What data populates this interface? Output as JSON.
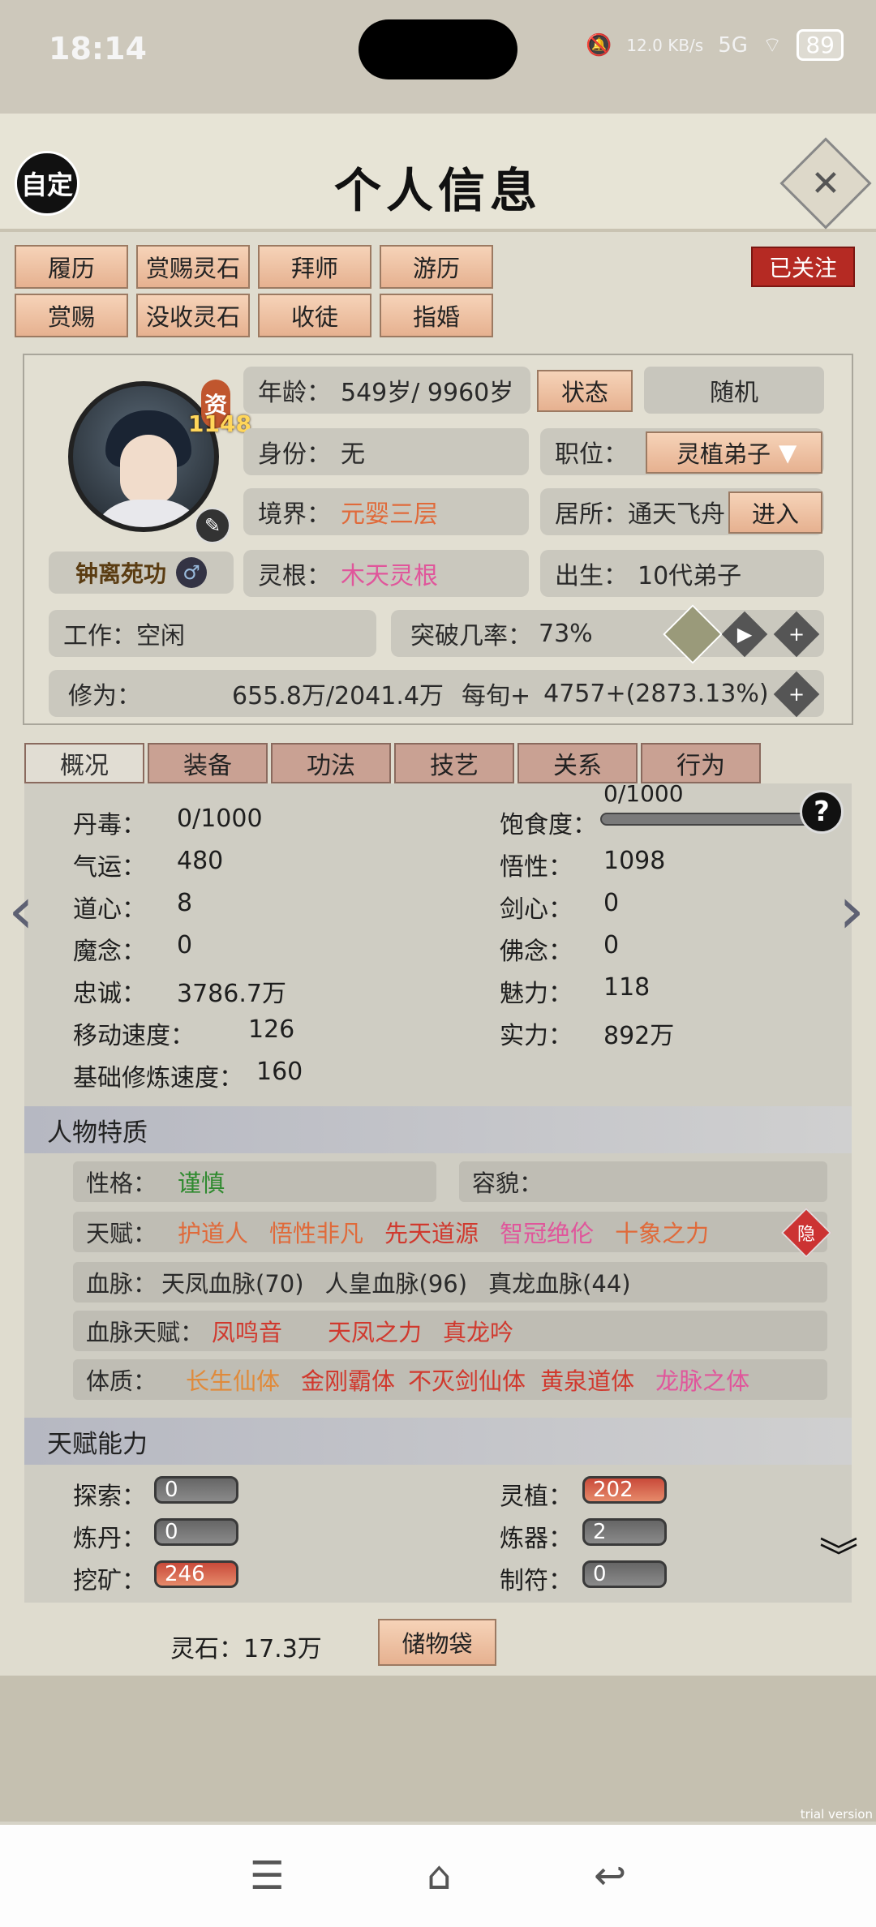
{
  "status_bar": {
    "time": "18:14",
    "network_speed": "12.0 KB/s",
    "signal": "5G",
    "battery": "89"
  },
  "header": {
    "custom_label": "自定",
    "title": "个人信息"
  },
  "actions": {
    "row1": [
      "履历",
      "赏赐灵石",
      "拜师",
      "游历"
    ],
    "row2": [
      "赏赐",
      "没收灵石",
      "收徒",
      "指婚"
    ],
    "follow_label": "已关注"
  },
  "profile": {
    "zi_label": "资",
    "zi_value": "1148",
    "name": "钟离苑功",
    "gender_symbol": "♂",
    "age_label": "年龄：",
    "age_value": "549岁/ 9960岁",
    "status_button": "状态",
    "random_button": "随机",
    "identity_label": "身份：",
    "identity_value": "无",
    "position_label": "职位：",
    "position_value": "灵植弟子",
    "realm_label": "境界：",
    "realm_value": "元婴三层",
    "residence_label": "居所：",
    "residence_value": "通天飞舟",
    "enter_button": "进入",
    "root_label": "灵根：",
    "root_value": "木天灵根",
    "birth_label": "出生：",
    "birth_value": "10代弟子",
    "work_label": "工作：",
    "work_value": "空闲",
    "breakthrough_label": "突破几率：",
    "breakthrough_value": "73%",
    "cultivation_label": "修为：",
    "cultivation_value": "655.8万/2041.4万",
    "per_turn_label": "每旬+",
    "per_turn_value": "4757+(2873.13%)"
  },
  "tabs": [
    "概况",
    "装备",
    "功法",
    "技艺",
    "关系",
    "行为"
  ],
  "stats_left": [
    {
      "label": "丹毒：",
      "value": "0/1000"
    },
    {
      "label": "气运：",
      "value": "480"
    },
    {
      "label": "道心：",
      "value": "8"
    },
    {
      "label": "魔念：",
      "value": "0"
    },
    {
      "label": "忠诚：",
      "value": "3786.7万"
    },
    {
      "label": "移动速度：",
      "value": "126"
    },
    {
      "label": "基础修炼速度：",
      "value": "160"
    }
  ],
  "stats_right": [
    {
      "label": "饱食度：",
      "value": "0/1000"
    },
    {
      "label": "悟性：",
      "value": "1098"
    },
    {
      "label": "剑心：",
      "value": "0"
    },
    {
      "label": "佛念：",
      "value": "0"
    },
    {
      "label": "魅力：",
      "value": "118"
    },
    {
      "label": "实力：",
      "value": "892万"
    }
  ],
  "help_symbol": "?",
  "traits": {
    "header": "人物特质",
    "personality_label": "性格：",
    "personality_value": "谨慎",
    "appearance_label": "容貌：",
    "talent_label": "天赋：",
    "talents": [
      "护道人",
      "悟性非凡",
      "先天道源",
      "智冠绝伦",
      "十象之力"
    ],
    "hide_label": "隐",
    "bloodline_label": "血脉：",
    "bloodlines": [
      "天凤血脉(70)",
      "人皇血脉(96)",
      "真龙血脉(44)"
    ],
    "bloodline_talent_label": "血脉天赋：",
    "bloodline_talents": [
      "凤鸣音",
      "天凤之力",
      "真龙吟"
    ],
    "physique_label": "体质：",
    "physiques": [
      "长生仙体",
      "金刚霸体",
      "不灭剑仙体",
      "黄泉道体",
      "龙脉之体"
    ]
  },
  "abilities": {
    "header": "天赋能力",
    "items": [
      {
        "label": "探索：",
        "value": "0"
      },
      {
        "label": "灵植：",
        "value": "202"
      },
      {
        "label": "炼丹：",
        "value": "0"
      },
      {
        "label": "炼器：",
        "value": "2"
      },
      {
        "label": "挖矿：",
        "value": "246"
      },
      {
        "label": "制符：",
        "value": "0"
      }
    ]
  },
  "footer": {
    "spirit_stone": "灵石：17.3万",
    "storage_button": "储物袋",
    "watermark": "trial version"
  },
  "colors": {
    "accent_red": "#b52a23",
    "peach_button": "#f0c8a8",
    "orange_text": "#e06a3a",
    "pink_text": "#e0569b",
    "green_text": "#2f8a2f"
  }
}
